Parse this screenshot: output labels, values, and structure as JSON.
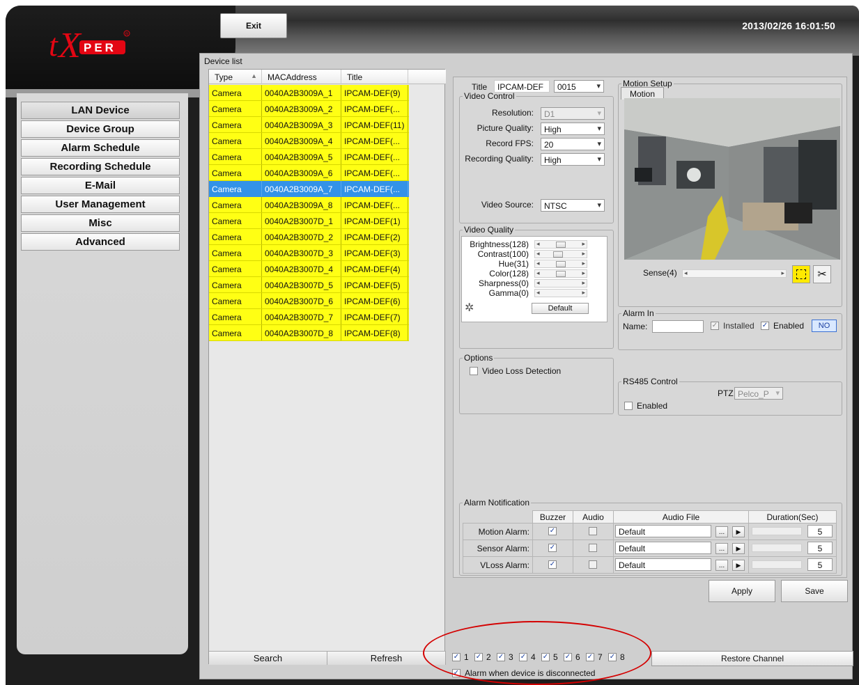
{
  "header": {
    "exit_label": "Exit",
    "datetime": "2013/02/26 16:01:50",
    "logo_text": "tXPER"
  },
  "nav": {
    "items": [
      {
        "label": "LAN Device"
      },
      {
        "label": "Device Group"
      },
      {
        "label": "Alarm Schedule"
      },
      {
        "label": "Recording Schedule"
      },
      {
        "label": "E-Mail"
      },
      {
        "label": "User Management"
      },
      {
        "label": "Misc"
      },
      {
        "label": "Advanced"
      }
    ]
  },
  "device_list": {
    "title": "Device list",
    "columns": [
      "Type",
      "MACAddress",
      "Title"
    ],
    "rows": [
      {
        "type": "Camera",
        "mac": "0040A2B3009A_1",
        "title": "IPCAM-DEF(9)"
      },
      {
        "type": "Camera",
        "mac": "0040A2B3009A_2",
        "title": "IPCAM-DEF(..."
      },
      {
        "type": "Camera",
        "mac": "0040A2B3009A_3",
        "title": "IPCAM-DEF(11)"
      },
      {
        "type": "Camera",
        "mac": "0040A2B3009A_4",
        "title": "IPCAM-DEF(..."
      },
      {
        "type": "Camera",
        "mac": "0040A2B3009A_5",
        "title": "IPCAM-DEF(..."
      },
      {
        "type": "Camera",
        "mac": "0040A2B3009A_6",
        "title": "IPCAM-DEF(..."
      },
      {
        "type": "Camera",
        "mac": "0040A2B3009A_7",
        "title": "IPCAM-DEF(..."
      },
      {
        "type": "Camera",
        "mac": "0040A2B3009A_8",
        "title": "IPCAM-DEF(..."
      },
      {
        "type": "Camera",
        "mac": "0040A2B3007D_1",
        "title": "IPCAM-DEF(1)"
      },
      {
        "type": "Camera",
        "mac": "0040A2B3007D_2",
        "title": "IPCAM-DEF(2)"
      },
      {
        "type": "Camera",
        "mac": "0040A2B3007D_3",
        "title": "IPCAM-DEF(3)"
      },
      {
        "type": "Camera",
        "mac": "0040A2B3007D_4",
        "title": "IPCAM-DEF(4)"
      },
      {
        "type": "Camera",
        "mac": "0040A2B3007D_5",
        "title": "IPCAM-DEF(5)"
      },
      {
        "type": "Camera",
        "mac": "0040A2B3007D_6",
        "title": "IPCAM-DEF(6)"
      },
      {
        "type": "Camera",
        "mac": "0040A2B3007D_7",
        "title": "IPCAM-DEF(7)"
      },
      {
        "type": "Camera",
        "mac": "0040A2B3007D_8",
        "title": "IPCAM-DEF(8)"
      }
    ],
    "selected_row": "0040A2B3009A_7",
    "search_label": "Search",
    "refresh_label": "Refresh"
  },
  "config": {
    "title_label": "Title",
    "title_value": "IPCAM-DEF",
    "channel_value": "0015",
    "video_control": {
      "legend": "Video Control",
      "resolution_label": "Resolution:",
      "resolution_value": "D1",
      "picture_quality_label": "Picture Quality:",
      "picture_quality_value": "High",
      "record_fps_label": "Record FPS:",
      "record_fps_value": "20",
      "recording_quality_label": "Recording Quality:",
      "recording_quality_value": "High",
      "video_source_label": "Video Source:",
      "video_source_value": "NTSC"
    },
    "video_quality": {
      "legend": "Video Quality",
      "brightness_label": "Brightness(128)",
      "contrast_label": "Contrast(100)",
      "hue_label": "Hue(31)",
      "color_label": "Color(128)",
      "sharpness_label": "Sharpness(0)",
      "gamma_label": "Gamma(0)",
      "default_label": "Default"
    },
    "motion_setup": {
      "legend": "Motion Setup",
      "tab_label": "Motion",
      "sense_label": "Sense(4)"
    },
    "alarm_in": {
      "legend": "Alarm In",
      "name_label": "Name:",
      "name_value": "",
      "installed_label": "Installed",
      "enabled_label": "Enabled",
      "status": "NO"
    },
    "options": {
      "legend": "Options",
      "video_loss_label": "Video Loss Detection"
    },
    "rs485": {
      "legend": "RS485 Control",
      "ptz_label": "PTZ",
      "ptz_value": "Pelco_P",
      "enabled_label": "Enabled"
    },
    "alarm_notification": {
      "legend": "Alarm Notification",
      "columns": [
        "Buzzer",
        "Audio",
        "Audio File",
        "Duration(Sec)"
      ],
      "rows": [
        {
          "label": "Motion Alarm:",
          "file": "Default",
          "duration": "5"
        },
        {
          "label": "Sensor Alarm:",
          "file": "Default",
          "duration": "5"
        },
        {
          "label": "VLoss Alarm:",
          "file": "Default",
          "duration": "5"
        }
      ],
      "browse_label": "..."
    },
    "apply_label": "Apply",
    "save_label": "Save"
  },
  "channels": {
    "items": [
      "1",
      "2",
      "3",
      "4",
      "5",
      "6",
      "7",
      "8"
    ],
    "restore_label": "Restore Channel",
    "alarm_disconnect_label": "Alarm when device is disconnected"
  },
  "colors": {
    "row_yellow": "#ffff14",
    "row_selected": "#3392e8",
    "annotation_red": "#d40000"
  }
}
